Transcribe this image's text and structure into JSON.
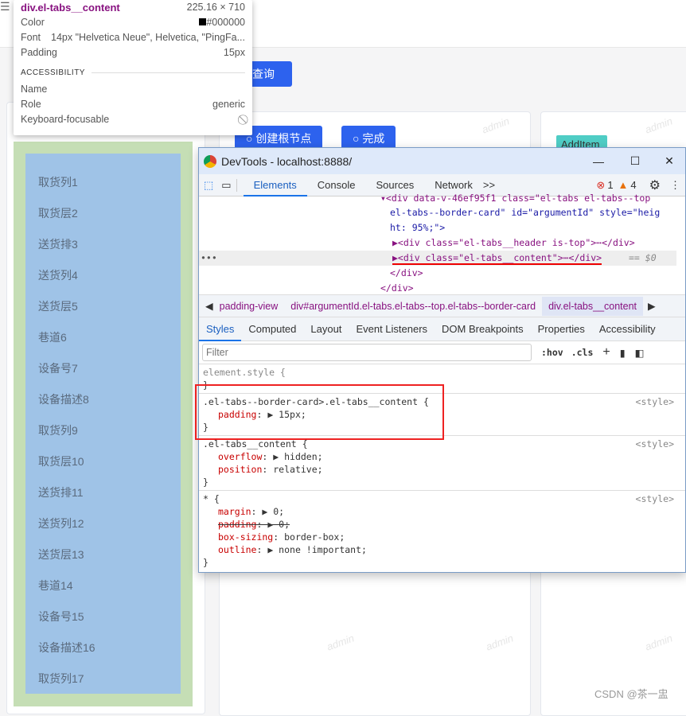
{
  "page": {
    "query_label": "查询",
    "create_root_label": "创建根节点",
    "done_label": "完成",
    "add_item_label": "AddItem",
    "watermark": "admin",
    "credit": "CSDN @茶一盅",
    "list_items": [
      "取货列1",
      "取货层2",
      "送货排3",
      "送货列4",
      "送货层5",
      "巷道6",
      "设备号7",
      "设备描述8",
      "取货列9",
      "取货层10",
      "送货排11",
      "送货列12",
      "送货层13",
      "巷道14",
      "设备号15",
      "设备描述16",
      "取货列17"
    ],
    "colors": {
      "outer_padding": "#c5deb5",
      "content": "#9fc3e7",
      "primary": "#2d62ee",
      "add_item": "#4fcdc5"
    }
  },
  "tooltip": {
    "element": "div.el-tabs__content",
    "size": "225.16 × 710",
    "color_label": "Color",
    "color_value": "#000000",
    "font_label": "Font",
    "font_value": "14px \"Helvetica Neue\", Helvetica, \"PingFa...",
    "padding_label": "Padding",
    "padding_value": "15px",
    "section": "ACCESSIBILITY",
    "name_label": "Name",
    "role_label": "Role",
    "role_value": "generic",
    "focus_label": "Keyboard-focusable"
  },
  "devtools": {
    "title": "DevTools - localhost:8888/",
    "tabs": [
      "Elements",
      "Console",
      "Sources",
      "Network"
    ],
    "more": ">>",
    "errors": "1",
    "warnings": "4",
    "dom": {
      "line1": "▾<div data-v-46ef95f1 class=\"el-tabs el-tabs--top",
      "line2": "el-tabs--border-card\" id=\"argumentId\" style=\"heig",
      "line3": "ht: 95%;\">",
      "line4": "▶<div class=\"el-tabs__header is-top\">⋯</div>",
      "line5": "▶<div class=\"el-tabs__content\">⋯</div>",
      "line5_suffix": "== $0",
      "line6": "</div>",
      "line7": "</div>",
      "gutter": "•••"
    },
    "breadcrumb": [
      "padding-view",
      "div#argumentId.el-tabs.el-tabs--top.el-tabs--border-card",
      "div.el-tabs__content"
    ],
    "subtabs": [
      "Styles",
      "Computed",
      "Layout",
      "Event Listeners",
      "DOM Breakpoints",
      "Properties",
      "Accessibility"
    ],
    "filter_placeholder": "Filter",
    "hov": ":hov",
    "cls": ".cls",
    "rules": [
      {
        "selector": "element.style {",
        "props": [],
        "source": ""
      },
      {
        "selector": ".el-tabs--border-card>.el-tabs__content {",
        "props": [
          {
            "name": "padding",
            "value": "▶ 15px;"
          }
        ],
        "source": "<style>"
      },
      {
        "selector": ".el-tabs__content {",
        "props": [
          {
            "name": "overflow",
            "value": "▶ hidden;"
          },
          {
            "name": "position",
            "value": "relative;"
          }
        ],
        "source": "<style>"
      },
      {
        "selector": "* {",
        "props": [
          {
            "name": "margin",
            "value": "▶ 0;"
          },
          {
            "name": "padding",
            "value": "▶ 0;"
          },
          {
            "name": "box-sizing",
            "value": "border-box;"
          },
          {
            "name": "outline",
            "value": "▶ none !important;"
          }
        ],
        "source": "<style>"
      }
    ]
  }
}
